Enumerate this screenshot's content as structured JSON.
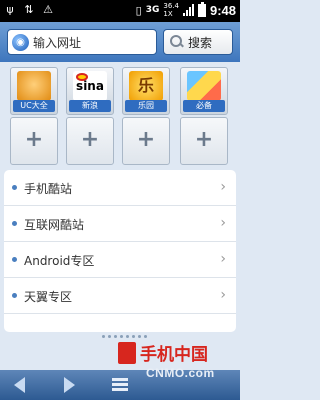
{
  "statusbar": {
    "left_icons": [
      "usb-icon",
      "sync-icon",
      "usb-debug-icon"
    ],
    "network": "3G",
    "net_mini_top": "36.4",
    "net_mini_bottom": "1X",
    "time": "9:48"
  },
  "toolbar": {
    "url_placeholder": "输入网址",
    "search_label": "搜索"
  },
  "quick_tiles": [
    {
      "label": "UC大全",
      "icon": "uc-squirrel-icon"
    },
    {
      "label": "新浪",
      "icon": "sina-icon",
      "icon_text": "sina"
    },
    {
      "label": "乐园",
      "icon": "leyuan-icon",
      "icon_text": "乐"
    },
    {
      "label": "必备",
      "icon": "bibei-icon"
    }
  ],
  "empty_tile_symbol": "+",
  "list": [
    {
      "label": "手机酷站"
    },
    {
      "label": "互联网酷站"
    },
    {
      "label": "Android专区"
    },
    {
      "label": "天翼专区"
    }
  ],
  "chevron": "›",
  "watermark": {
    "title": "手机中国",
    "subtitle": "CNMO.com"
  },
  "colors": {
    "toolbar": "#3e76bd",
    "background": "#dfe8f3",
    "bottom_bar": "#2d5a92",
    "watermark_red": "#d7261e"
  }
}
